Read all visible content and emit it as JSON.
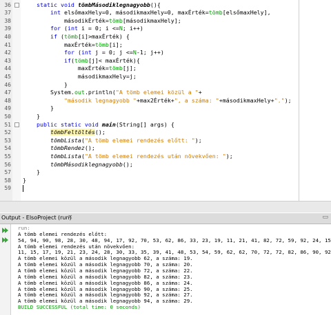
{
  "editor": {
    "lines": [
      {
        "num": "36",
        "parts": [
          [
            "    ",
            ""
          ],
          [
            "static void ",
            "kw"
          ],
          [
            "tömbMásodiklegnagyobb",
            "fn"
          ],
          [
            "(){",
            ""
          ]
        ]
      },
      {
        "num": "37",
        "parts": [
          [
            "        ",
            ""
          ],
          [
            "int ",
            "kw"
          ],
          [
            "elsőmaxHely=0, másodikmaxHely=0, maxÉrték=",
            ""
          ],
          [
            "tömb",
            "fld"
          ],
          [
            "[elsőmaxHely],",
            ""
          ]
        ]
      },
      {
        "num": "38",
        "parts": [
          [
            "            másodikÉrték=",
            ""
          ],
          [
            "tömb",
            "fld"
          ],
          [
            "[másodikmaxHely];",
            ""
          ]
        ]
      },
      {
        "num": "39",
        "parts": [
          [
            "        ",
            ""
          ],
          [
            "for ",
            "kw"
          ],
          [
            "(",
            ""
          ],
          [
            "int ",
            "kw"
          ],
          [
            "i = 0; i <=",
            ""
          ],
          [
            "N",
            "fld"
          ],
          [
            "; i++)",
            ""
          ]
        ]
      },
      {
        "num": "40",
        "parts": [
          [
            "        ",
            ""
          ],
          [
            "if ",
            "kw"
          ],
          [
            "(",
            ""
          ],
          [
            "tömb",
            "fld"
          ],
          [
            "[i]>maxÉrték) {",
            ""
          ]
        ]
      },
      {
        "num": "41",
        "parts": [
          [
            "            maxÉrték=",
            ""
          ],
          [
            "tömb",
            "fld"
          ],
          [
            "[i];",
            ""
          ]
        ]
      },
      {
        "num": "42",
        "parts": [
          [
            "            ",
            ""
          ],
          [
            "for ",
            "kw"
          ],
          [
            "(",
            ""
          ],
          [
            "int ",
            "kw"
          ],
          [
            "j = 0; j <=",
            ""
          ],
          [
            "N",
            "fld"
          ],
          [
            "-1; j++)",
            ""
          ]
        ]
      },
      {
        "num": "43",
        "parts": [
          [
            "            ",
            ""
          ],
          [
            "if",
            "kw"
          ],
          [
            "(",
            ""
          ],
          [
            "tömb",
            "fld"
          ],
          [
            "[j]< maxÉrték){",
            ""
          ]
        ]
      },
      {
        "num": "44",
        "parts": [
          [
            "                maxÉrték=",
            ""
          ],
          [
            "tömb",
            "fld"
          ],
          [
            "[j];",
            ""
          ]
        ]
      },
      {
        "num": "45",
        "parts": [
          [
            "                másodikmaxHely=j;",
            ""
          ]
        ]
      },
      {
        "num": "46",
        "parts": [
          [
            "            }",
            ""
          ]
        ]
      },
      {
        "num": "47",
        "parts": [
          [
            "        System.",
            ""
          ],
          [
            "out",
            "fld"
          ],
          [
            ".println(",
            ""
          ],
          [
            "\"A tömb elemei közül a \"",
            "str"
          ],
          [
            "+",
            ""
          ]
        ]
      },
      {
        "num": "48",
        "parts": [
          [
            "            ",
            ""
          ],
          [
            "\"második legnagyobb \"",
            "str"
          ],
          [
            "+max2Érték+",
            ""
          ],
          [
            "\", a száma: \"",
            "str"
          ],
          [
            "+másodikmaxHely+",
            ""
          ],
          [
            "\".\"",
            "str"
          ],
          [
            ");",
            ""
          ]
        ]
      },
      {
        "num": "49",
        "parts": [
          [
            "        }",
            ""
          ]
        ]
      },
      {
        "num": "50",
        "parts": [
          [
            "    }",
            ""
          ]
        ]
      },
      {
        "num": "51",
        "parts": [
          [
            "    ",
            ""
          ],
          [
            "public static void ",
            "kw"
          ],
          [
            "main",
            "fn"
          ],
          [
            "(String[] args) {",
            ""
          ]
        ]
      },
      {
        "num": "52",
        "parts": [
          [
            "        ",
            ""
          ],
          [
            "tömbFeltöltés",
            "it hl"
          ],
          [
            "();",
            ""
          ]
        ]
      },
      {
        "num": "53",
        "parts": [
          [
            "        ",
            ""
          ],
          [
            "tömbLista",
            "it"
          ],
          [
            "(",
            ""
          ],
          [
            "\"A tömb elemei rendezés előtt: \"",
            "str"
          ],
          [
            ");",
            ""
          ]
        ]
      },
      {
        "num": "54",
        "parts": [
          [
            "        ",
            ""
          ],
          [
            "tömbRendez",
            "it"
          ],
          [
            "();",
            ""
          ]
        ]
      },
      {
        "num": "55",
        "parts": [
          [
            "        ",
            ""
          ],
          [
            "tömbLista",
            "it"
          ],
          [
            "(",
            ""
          ],
          [
            "\"A tömb elemei rendezés után növekvően: \"",
            "str"
          ],
          [
            ");",
            ""
          ]
        ]
      },
      {
        "num": "56",
        "parts": [
          [
            "        ",
            ""
          ],
          [
            "tömbMásodiklegnagyobb",
            "it"
          ],
          [
            "();",
            ""
          ]
        ]
      },
      {
        "num": "57",
        "parts": [
          [
            "    }",
            ""
          ]
        ]
      },
      {
        "num": "58",
        "parts": [
          [
            "}",
            ""
          ]
        ]
      },
      {
        "num": "59",
        "parts": [
          [
            "",
            ""
          ]
        ]
      }
    ]
  },
  "output": {
    "tab_label": "Output - ElsoProject (run)",
    "tab_close": "×",
    "tab_controls": "▭",
    "lines": [
      {
        "text": "run:",
        "cls": "olg"
      },
      {
        "text": "A tömb elemei rendezés előtt:",
        "cls": ""
      },
      {
        "text": "54, 94, 90, 98, 28, 30, 48, 94, 17, 92, 70, 53, 62, 86, 33, 23, 19, 11, 21, 41, 82, 72, 59, 92, 24, 15,",
        "cls": ""
      },
      {
        "text": "A tömb elemei rendezés után növekvően:",
        "cls": ""
      },
      {
        "text": "11, 15, 17, 19, 21, 23, 24, 28, 30, 33, 35, 39, 41, 48, 53, 54, 59, 62, 62, 70, 72, 72, 82, 86, 90, 92,",
        "cls": ""
      },
      {
        "text": "A tömb elemei közül a második legnagyobb 62, a száma: 19.",
        "cls": ""
      },
      {
        "text": "A tömb elemei közül a második legnagyobb 70, a száma: 20.",
        "cls": ""
      },
      {
        "text": "A tömb elemei közül a második legnagyobb 72, a száma: 22.",
        "cls": ""
      },
      {
        "text": "A tömb elemei közül a második legnagyobb 82, a száma: 23.",
        "cls": ""
      },
      {
        "text": "A tömb elemei közül a második legnagyobb 86, a száma: 24.",
        "cls": ""
      },
      {
        "text": "A tömb elemei közül a második legnagyobb 90, a száma: 25.",
        "cls": ""
      },
      {
        "text": "A tömb elemei közül a második legnagyobb 92, a száma: 27.",
        "cls": ""
      },
      {
        "text": "A tömb elemei közül a második legnagyobb 94, a száma: 29.",
        "cls": ""
      },
      {
        "text": "BUILD SUCCESSFUL (total time: 0 seconds)",
        "cls": "olsucc"
      }
    ]
  },
  "colors": {
    "keyword": "#0000e6",
    "field": "#009900",
    "string": "#ce7b00",
    "highlight": "#fff6b0",
    "success": "#009900"
  }
}
